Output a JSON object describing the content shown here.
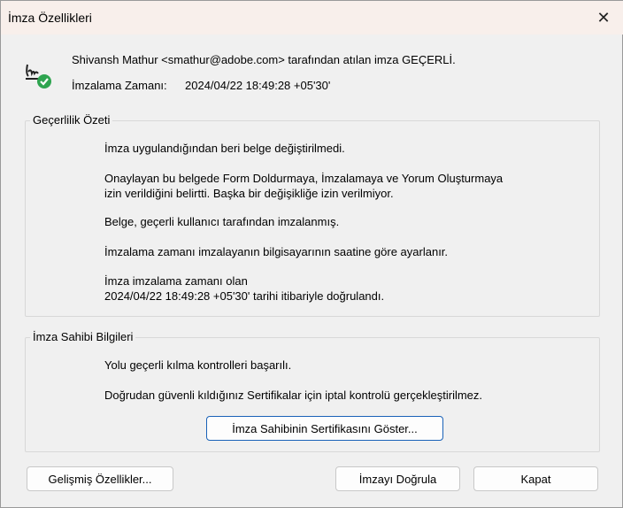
{
  "window": {
    "title": "İmza Özellikleri",
    "close": "✕"
  },
  "header": {
    "status": "Shivansh Mathur <smathur@adobe.com> tarafından atılan imza GEÇERLİ.",
    "time_label": "İmzalama Zamanı:",
    "time_value": "2024/04/22 18:49:28 +05'30'"
  },
  "validity": {
    "label": "Geçerlilik Özeti",
    "lines": [
      "İmza uygulandığından beri belge değiştirilmedi.",
      "Onaylayan bu belgede Form Doldurmaya, İmzalamaya ve Yorum Oluşturmaya",
      "izin verildiğini belirtti. Başka bir değişikliğe izin verilmiyor.",
      "Belge, geçerli kullanıcı tarafından imzalanmış.",
      "İmzalama zamanı imzalayanın bilgisayarının saatine göre ayarlanır.",
      "İmza imzalama zamanı olan",
      "2024/04/22 18:49:28 +05'30' tarihi itibariyle doğrulandı."
    ]
  },
  "signer": {
    "label": "İmza Sahibi Bilgileri",
    "lines": [
      "Yolu geçerli kılma kontrolleri başarılı.",
      "Doğrudan güvenli kıldığınız Sertifikalar için iptal kontrolü gerçekleştirilmez."
    ],
    "show_cert": "İmza Sahibinin Sertifikasını Göster..."
  },
  "buttons": {
    "advanced": "Gelişmiş Özellikler...",
    "validate": "İmzayı Doğrula",
    "close": "Kapat"
  },
  "colors": {
    "check": "#2ea44f",
    "accent": "#1a62b8"
  }
}
